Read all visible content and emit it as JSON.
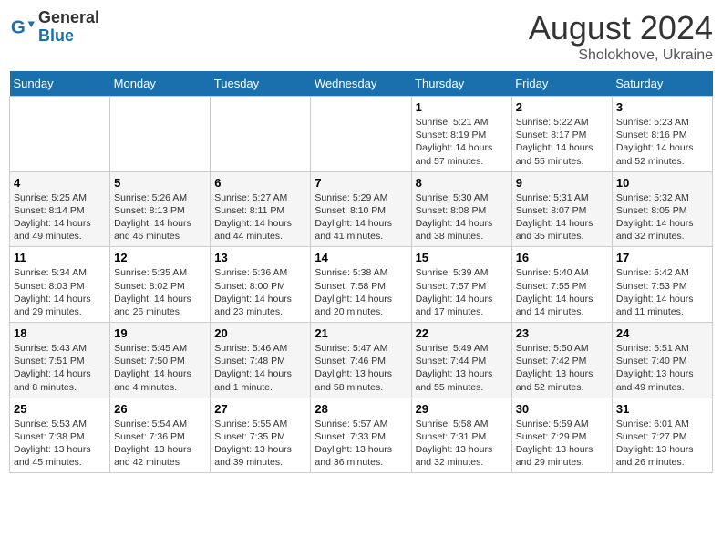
{
  "header": {
    "logo_general": "General",
    "logo_blue": "Blue",
    "month_year": "August 2024",
    "location": "Sholokhove, Ukraine"
  },
  "weekdays": [
    "Sunday",
    "Monday",
    "Tuesday",
    "Wednesday",
    "Thursday",
    "Friday",
    "Saturday"
  ],
  "weeks": [
    [
      {
        "day": "",
        "info": ""
      },
      {
        "day": "",
        "info": ""
      },
      {
        "day": "",
        "info": ""
      },
      {
        "day": "",
        "info": ""
      },
      {
        "day": "1",
        "info": "Sunrise: 5:21 AM\nSunset: 8:19 PM\nDaylight: 14 hours\nand 57 minutes."
      },
      {
        "day": "2",
        "info": "Sunrise: 5:22 AM\nSunset: 8:17 PM\nDaylight: 14 hours\nand 55 minutes."
      },
      {
        "day": "3",
        "info": "Sunrise: 5:23 AM\nSunset: 8:16 PM\nDaylight: 14 hours\nand 52 minutes."
      }
    ],
    [
      {
        "day": "4",
        "info": "Sunrise: 5:25 AM\nSunset: 8:14 PM\nDaylight: 14 hours\nand 49 minutes."
      },
      {
        "day": "5",
        "info": "Sunrise: 5:26 AM\nSunset: 8:13 PM\nDaylight: 14 hours\nand 46 minutes."
      },
      {
        "day": "6",
        "info": "Sunrise: 5:27 AM\nSunset: 8:11 PM\nDaylight: 14 hours\nand 44 minutes."
      },
      {
        "day": "7",
        "info": "Sunrise: 5:29 AM\nSunset: 8:10 PM\nDaylight: 14 hours\nand 41 minutes."
      },
      {
        "day": "8",
        "info": "Sunrise: 5:30 AM\nSunset: 8:08 PM\nDaylight: 14 hours\nand 38 minutes."
      },
      {
        "day": "9",
        "info": "Sunrise: 5:31 AM\nSunset: 8:07 PM\nDaylight: 14 hours\nand 35 minutes."
      },
      {
        "day": "10",
        "info": "Sunrise: 5:32 AM\nSunset: 8:05 PM\nDaylight: 14 hours\nand 32 minutes."
      }
    ],
    [
      {
        "day": "11",
        "info": "Sunrise: 5:34 AM\nSunset: 8:03 PM\nDaylight: 14 hours\nand 29 minutes."
      },
      {
        "day": "12",
        "info": "Sunrise: 5:35 AM\nSunset: 8:02 PM\nDaylight: 14 hours\nand 26 minutes."
      },
      {
        "day": "13",
        "info": "Sunrise: 5:36 AM\nSunset: 8:00 PM\nDaylight: 14 hours\nand 23 minutes."
      },
      {
        "day": "14",
        "info": "Sunrise: 5:38 AM\nSunset: 7:58 PM\nDaylight: 14 hours\nand 20 minutes."
      },
      {
        "day": "15",
        "info": "Sunrise: 5:39 AM\nSunset: 7:57 PM\nDaylight: 14 hours\nand 17 minutes."
      },
      {
        "day": "16",
        "info": "Sunrise: 5:40 AM\nSunset: 7:55 PM\nDaylight: 14 hours\nand 14 minutes."
      },
      {
        "day": "17",
        "info": "Sunrise: 5:42 AM\nSunset: 7:53 PM\nDaylight: 14 hours\nand 11 minutes."
      }
    ],
    [
      {
        "day": "18",
        "info": "Sunrise: 5:43 AM\nSunset: 7:51 PM\nDaylight: 14 hours\nand 8 minutes."
      },
      {
        "day": "19",
        "info": "Sunrise: 5:45 AM\nSunset: 7:50 PM\nDaylight: 14 hours\nand 4 minutes."
      },
      {
        "day": "20",
        "info": "Sunrise: 5:46 AM\nSunset: 7:48 PM\nDaylight: 14 hours\nand 1 minute."
      },
      {
        "day": "21",
        "info": "Sunrise: 5:47 AM\nSunset: 7:46 PM\nDaylight: 13 hours\nand 58 minutes."
      },
      {
        "day": "22",
        "info": "Sunrise: 5:49 AM\nSunset: 7:44 PM\nDaylight: 13 hours\nand 55 minutes."
      },
      {
        "day": "23",
        "info": "Sunrise: 5:50 AM\nSunset: 7:42 PM\nDaylight: 13 hours\nand 52 minutes."
      },
      {
        "day": "24",
        "info": "Sunrise: 5:51 AM\nSunset: 7:40 PM\nDaylight: 13 hours\nand 49 minutes."
      }
    ],
    [
      {
        "day": "25",
        "info": "Sunrise: 5:53 AM\nSunset: 7:38 PM\nDaylight: 13 hours\nand 45 minutes."
      },
      {
        "day": "26",
        "info": "Sunrise: 5:54 AM\nSunset: 7:36 PM\nDaylight: 13 hours\nand 42 minutes."
      },
      {
        "day": "27",
        "info": "Sunrise: 5:55 AM\nSunset: 7:35 PM\nDaylight: 13 hours\nand 39 minutes."
      },
      {
        "day": "28",
        "info": "Sunrise: 5:57 AM\nSunset: 7:33 PM\nDaylight: 13 hours\nand 36 minutes."
      },
      {
        "day": "29",
        "info": "Sunrise: 5:58 AM\nSunset: 7:31 PM\nDaylight: 13 hours\nand 32 minutes."
      },
      {
        "day": "30",
        "info": "Sunrise: 5:59 AM\nSunset: 7:29 PM\nDaylight: 13 hours\nand 29 minutes."
      },
      {
        "day": "31",
        "info": "Sunrise: 6:01 AM\nSunset: 7:27 PM\nDaylight: 13 hours\nand 26 minutes."
      }
    ]
  ]
}
